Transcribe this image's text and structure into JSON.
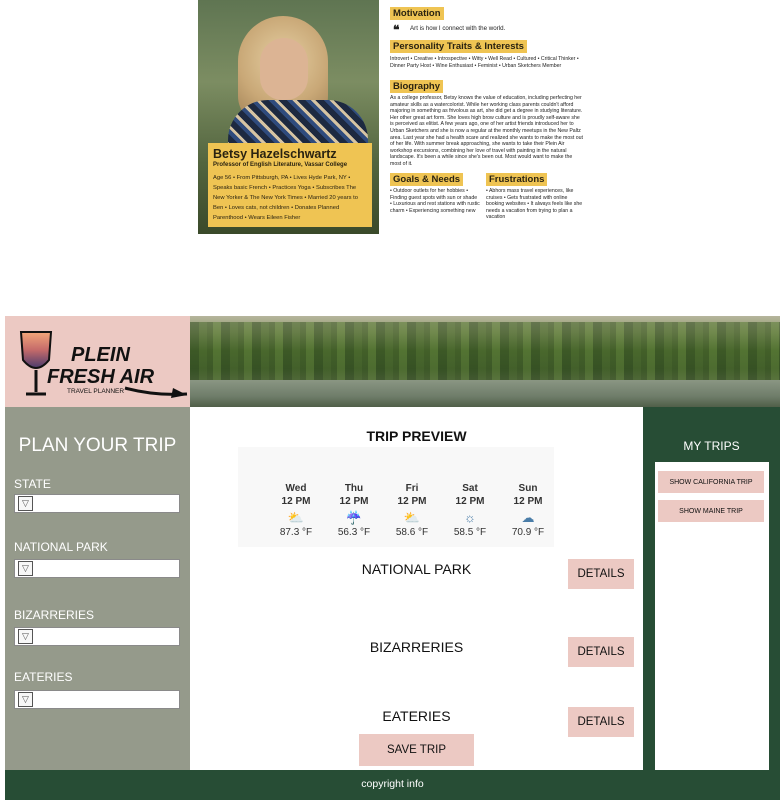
{
  "persona": {
    "name": "Betsy Hazelschwartz",
    "role": "Professor of English Literature, Vassar College",
    "details": "Age 56 • From Pittsburgh, PA • Lives Hyde Park, NY • Speaks basic French • Practices Yoga • Subscribes The New Yorker & The New York Times • Married 20 years to Ben • Loves cats, not children • Donates Planned Parenthood • Wears Eileen Fisher",
    "motivation_heading": "Motivation",
    "motivation_quote": "Art is how I connect with the world.",
    "traits_heading": "Personality Traits & Interests",
    "traits_text": "Introvert • Creative • Introspective • Witty • Well Read • Cultured • Critical Thinker • Dinner Party Host • Wine Enthusiast • Feminist • Urban Sketchers Member",
    "biography_heading": "Biography",
    "biography_text": "As a college professor, Betsy knows the value of education, including perfecting her amateur skills as a watercolorist. While her working class parents couldn't afford majoring in something as frivolous as art, she did get a degree in studying literature. Her other great art form. She loves high brow culture and is proudly self-aware she is perceived as elitist. A few years ago, one of her artist friends introduced her to Urban Sketchers and she is now a regular at the monthly meetups in the New Paltz area. Last year she had a health scare and realized she wants to make the most out of her life. With summer break approaching, she wants to take their Plein Air workshop excursions, combining her love of travel with painting in the natural landscape. It's been a while since she's been out. Most would want to make the most of it.",
    "goals_heading": "Goals & Needs",
    "goals_text": "• Outdoor outlets for her hobbies • Finding guest spots with sun or shade • Luxurious and rest stations with rustic charm • Experiencing something new",
    "frustrations_heading": "Frustrations",
    "frustrations_text": "• Abhors mass travel experiences, like cruises • Gets frustrated with online booking websites • It always feels like she needs a vacation from trying to plan a vacation"
  },
  "app": {
    "logo": {
      "line1": "PLEIN",
      "line2": "FRESH AIR",
      "tagline": "TRAVEL PLANNER"
    },
    "sidebar": {
      "title": "PLAN YOUR TRIP",
      "fields": [
        {
          "label": "STATE",
          "value": ""
        },
        {
          "label": "NATIONAL PARK",
          "value": ""
        },
        {
          "label": "BIZARRERIES",
          "value": ""
        },
        {
          "label": "EATERIES",
          "value": ""
        }
      ]
    },
    "preview": {
      "title": "TRIP PREVIEW",
      "weather": [
        {
          "day": "Wed",
          "time": "12 PM",
          "icon": "partly-sunny-icon",
          "temp": "87.3 °F"
        },
        {
          "day": "Thu",
          "time": "12 PM",
          "icon": "rain-cloud-icon",
          "temp": "56.3 °F"
        },
        {
          "day": "Fri",
          "time": "12 PM",
          "icon": "partly-sunny-icon",
          "temp": "58.6 °F"
        },
        {
          "day": "Sat",
          "time": "12 PM",
          "icon": "sun-icon",
          "temp": "58.5 °F"
        },
        {
          "day": "Sun",
          "time": "12 PM",
          "icon": "cloud-icon",
          "temp": "70.9 °F"
        }
      ],
      "sections": [
        {
          "label": "NATIONAL PARK",
          "button": "DETAILS"
        },
        {
          "label": "BIZARRERIES",
          "button": "DETAILS"
        },
        {
          "label": "EATERIES",
          "button": "DETAILS"
        }
      ],
      "save_label": "SAVE TRIP"
    },
    "trips": {
      "title": "MY TRIPS",
      "items": [
        "SHOW CALIFORNIA TRIP",
        "SHOW MAINE TRIP"
      ]
    },
    "footer": "copyright info"
  },
  "colors": {
    "pink": "#ecc9c3",
    "sage": "#959a8b",
    "forest": "#274d35",
    "mustard": "#efc453"
  }
}
